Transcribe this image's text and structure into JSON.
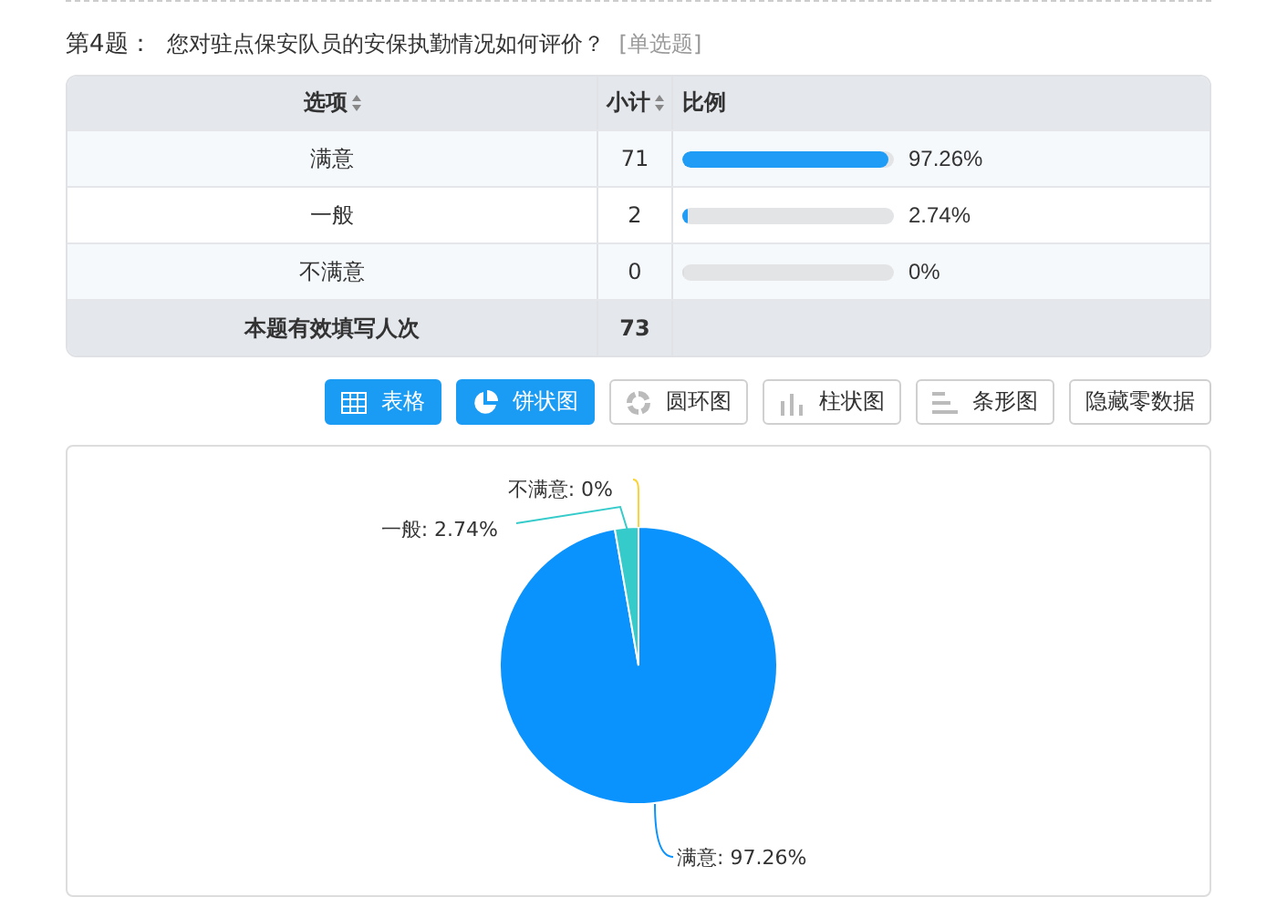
{
  "question": {
    "number": "第4题：",
    "text": "您对驻点保安队员的安保执勤情况如何评价？",
    "type": "[单选题]"
  },
  "table": {
    "columns": [
      {
        "label": "选项",
        "sortable": true
      },
      {
        "label": "小计",
        "sortable": true
      },
      {
        "label": "比例",
        "sortable": false
      }
    ],
    "rows": [
      {
        "option": "满意",
        "count": "71",
        "level": 0.9726,
        "percent": "97.26%"
      },
      {
        "option": "一般",
        "count": "2",
        "level": 0.0274,
        "percent": "2.74%"
      },
      {
        "option": "不满意",
        "count": "0",
        "level": 0,
        "percent": "0%"
      }
    ],
    "footer": {
      "label": "本题有效填写人次",
      "count": "73"
    }
  },
  "buttons": [
    {
      "label": "表格",
      "kind": "table",
      "selected": true
    },
    {
      "label": "饼状图",
      "kind": "pie",
      "selected": true
    },
    {
      "label": "圆环图",
      "kind": "donut",
      "selected": false
    },
    {
      "label": "柱状图",
      "kind": "column",
      "selected": false
    },
    {
      "label": "条形图",
      "kind": "bar",
      "selected": false
    },
    {
      "label": "隐藏零数据",
      "kind": "text",
      "selected": false
    }
  ],
  "chart": {
    "chart_data": {
      "type": "pie",
      "values": [
        97.26,
        2.74,
        0
      ],
      "colors": [
        "#0a93fd",
        "#36cbcb",
        "#fad337"
      ],
      "value_labels": [
        "满意: 97.26%",
        "一般: 2.74%",
        "不满意: 0%"
      ]
    }
  }
}
